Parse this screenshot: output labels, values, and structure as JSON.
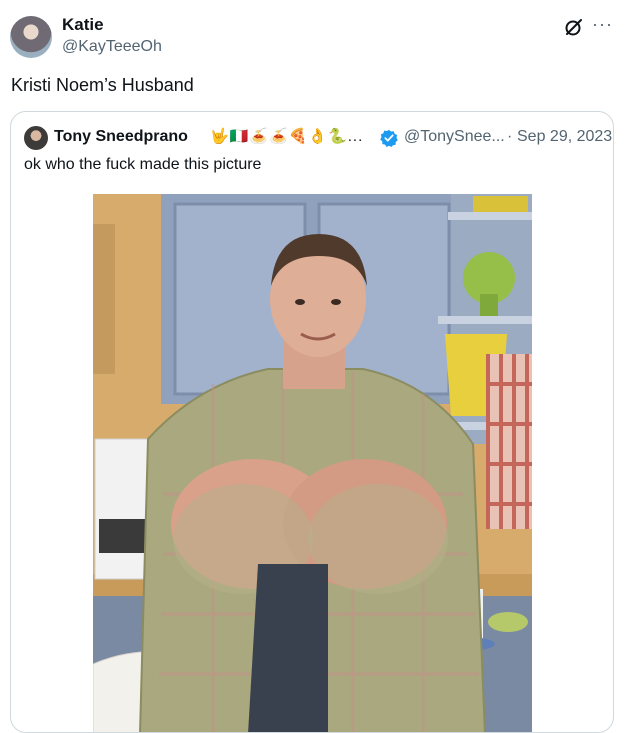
{
  "tweet": {
    "author_name": "Katie",
    "author_handle": "@KayTeeeOh",
    "text": "Kristi Noem’s Husband",
    "icons": [
      "grok-icon",
      "more-icon"
    ],
    "more_label": "···"
  },
  "quoted_tweet": {
    "author_name": "Tony Sneedprano",
    "author_emojis": "🤟🇮🇹🍝🍝🍕👌🐍...",
    "verified": true,
    "author_handle": "@TonySnee...",
    "separator": "·",
    "date": "Sep 29, 2023",
    "text": "ok who the fuck made this picture",
    "media": {
      "type": "photo",
      "icon": "photo"
    }
  },
  "colors": {
    "text": "#0f1419",
    "secondary": "#536471",
    "border": "#cfd9de",
    "verified": "#1d9bf0"
  }
}
